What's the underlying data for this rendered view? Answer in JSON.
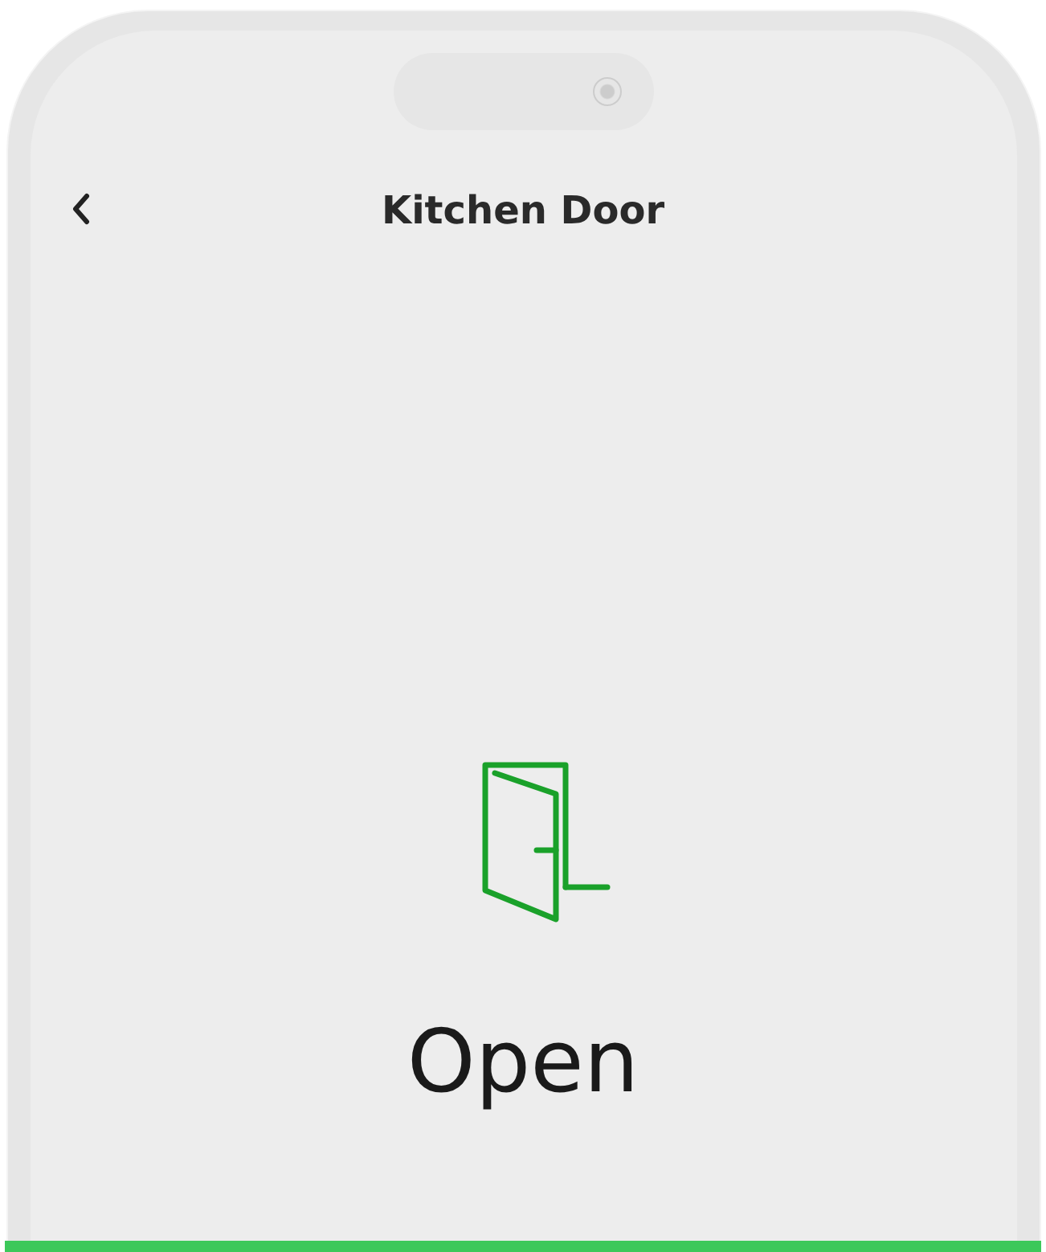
{
  "header": {
    "title": "Kitchen Door"
  },
  "door": {
    "status": "Open",
    "open": true
  }
}
